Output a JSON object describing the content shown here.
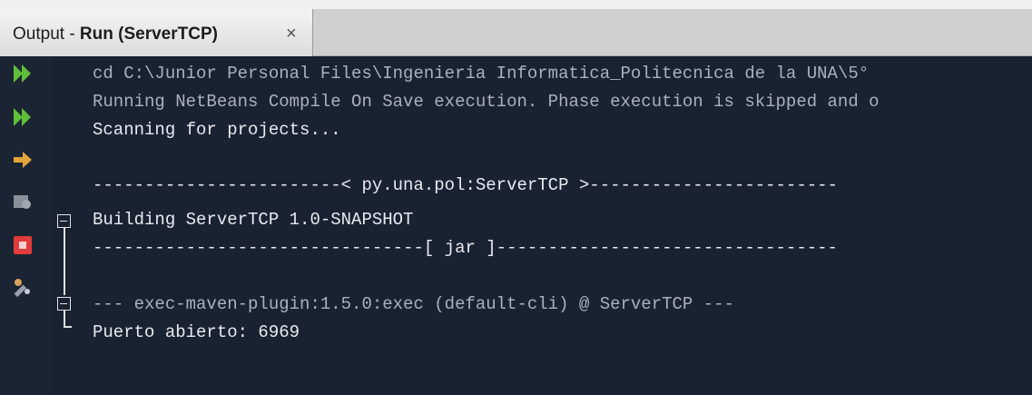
{
  "tab": {
    "prefix": "Output - ",
    "run_label": "Run (ServerTCP)",
    "close": "×"
  },
  "toolbar": {
    "items": [
      "rerun-icon",
      "rerun-with-options-icon",
      "step-icon",
      "stop-gray-icon",
      "stop-icon",
      "settings-icon"
    ]
  },
  "console": {
    "lines": [
      "cd C:\\Junior Personal Files\\Ingenieria Informatica_Politecnica de la UNA\\5°",
      "Running NetBeans Compile On Save execution. Phase execution is skipped and o",
      "Scanning for projects...",
      "------------------------< py.una.pol:ServerTCP >------------------------",
      "Building ServerTCP 1.0-SNAPSHOT",
      "--------------------------------[ jar ]---------------------------------",
      "--- exec-maven-plugin:1.5.0:exec (default-cli) @ ServerTCP ---",
      "Puerto abierto: 6969"
    ]
  }
}
